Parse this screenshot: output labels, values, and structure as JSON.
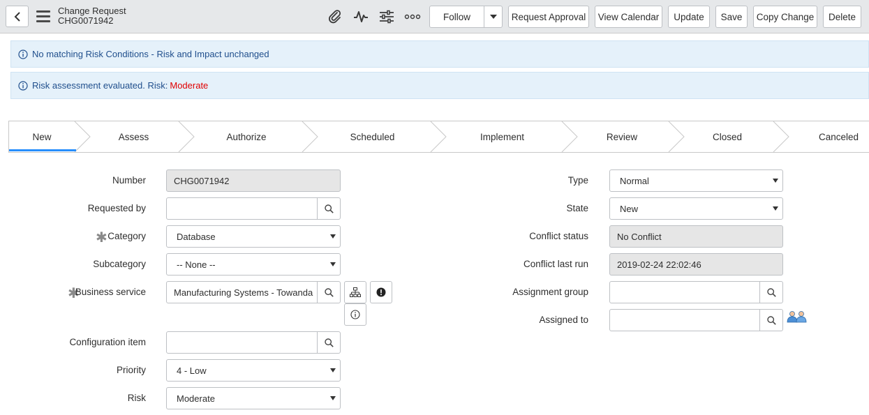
{
  "header": {
    "record_type": "Change Request",
    "record_number": "CHG0071942",
    "icons": [
      "back-icon",
      "menu-icon",
      "attachment-icon",
      "activity-icon",
      "settings-sliders-icon",
      "more-icon"
    ],
    "follow_label": "Follow",
    "buttons": {
      "request_approval": "Request Approval",
      "view_calendar": "View Calendar",
      "update": "Update",
      "save": "Save",
      "copy_change": "Copy Change",
      "delete": "Delete"
    }
  },
  "messages": {
    "msg1": "No matching Risk Conditions - Risk and Impact unchanged",
    "msg2_prefix": "Risk assessment evaluated. Risk:",
    "msg2_risk": "Moderate",
    "risk_color": "#e00000",
    "info_color": "#1f4e8c"
  },
  "process_flow": {
    "stages": [
      "New",
      "Assess",
      "Authorize",
      "Scheduled",
      "Implement",
      "Review",
      "Closed",
      "Canceled"
    ],
    "active": "New",
    "active_color": "#278efc"
  },
  "form": {
    "left": {
      "number": {
        "label": "Number",
        "value": "CHG0071942"
      },
      "requested_by": {
        "label": "Requested by",
        "value": ""
      },
      "category": {
        "label": "Category",
        "value": "Database",
        "required": true
      },
      "subcategory": {
        "label": "Subcategory",
        "value": "-- None --"
      },
      "business_service": {
        "label": "Business service",
        "value": "Manufacturing Systems - Towanda",
        "required": true
      },
      "configuration_item": {
        "label": "Configuration item",
        "value": ""
      },
      "priority": {
        "label": "Priority",
        "value": "4 - Low"
      },
      "risk": {
        "label": "Risk",
        "value": "Moderate"
      }
    },
    "right": {
      "type": {
        "label": "Type",
        "value": "Normal"
      },
      "state": {
        "label": "State",
        "value": "New"
      },
      "conflict_status": {
        "label": "Conflict status",
        "value": "No Conflict"
      },
      "conflict_last_run": {
        "label": "Conflict last run",
        "value": "2019-02-24 22:02:46"
      },
      "assignment_group": {
        "label": "Assignment group",
        "value": ""
      },
      "assigned_to": {
        "label": "Assigned to",
        "value": ""
      }
    }
  }
}
